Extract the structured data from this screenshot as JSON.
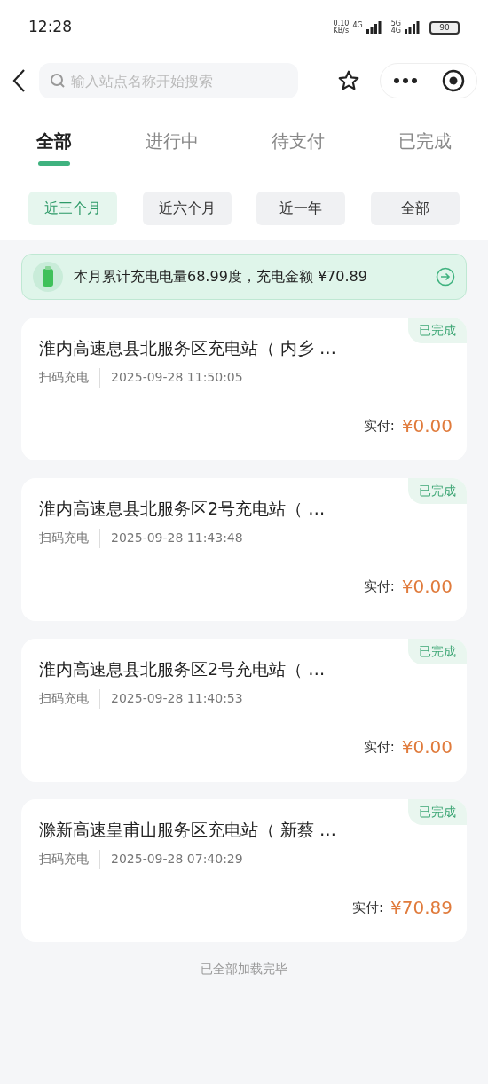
{
  "status_bar": {
    "time": "12:28",
    "speed": "0.10",
    "speed_unit": "KB/s",
    "network_1": "4G",
    "network_2": "5G",
    "network_2_sub": "4G",
    "battery": "90"
  },
  "search": {
    "placeholder": "输入站点名称开始搜索"
  },
  "tabs": [
    {
      "label": "全部",
      "selected": true
    },
    {
      "label": "进行中",
      "selected": false
    },
    {
      "label": "待支付",
      "selected": false
    },
    {
      "label": "已完成",
      "selected": false
    }
  ],
  "filters": [
    {
      "label": "近三个月",
      "selected": true
    },
    {
      "label": "近六个月",
      "selected": false
    },
    {
      "label": "近一年",
      "selected": false
    },
    {
      "label": "全部",
      "selected": false
    }
  ],
  "summary": {
    "text": "本月累计充电电量68.99度，充电金额 ¥70.89"
  },
  "orders": [
    {
      "status": "已完成",
      "station": "淮内高速息县北服务区充电站（ 内乡 …",
      "method": "扫码充电",
      "time": "2025-09-28 11:50:05",
      "paid_label": "实付:",
      "amount": "¥0.00"
    },
    {
      "status": "已完成",
      "station": "淮内高速息县北服务区2号充电站（ …",
      "method": "扫码充电",
      "time": "2025-09-28 11:43:48",
      "paid_label": "实付:",
      "amount": "¥0.00"
    },
    {
      "status": "已完成",
      "station": "淮内高速息县北服务区2号充电站（ …",
      "method": "扫码充电",
      "time": "2025-09-28 11:40:53",
      "paid_label": "实付:",
      "amount": "¥0.00"
    },
    {
      "status": "已完成",
      "station": "滁新高速皇甫山服务区充电站（ 新蔡 …",
      "method": "扫码充电",
      "time": "2025-09-28 07:40:29",
      "paid_label": "实付:",
      "amount": "¥70.89"
    }
  ],
  "footer": "已全部加载完毕"
}
